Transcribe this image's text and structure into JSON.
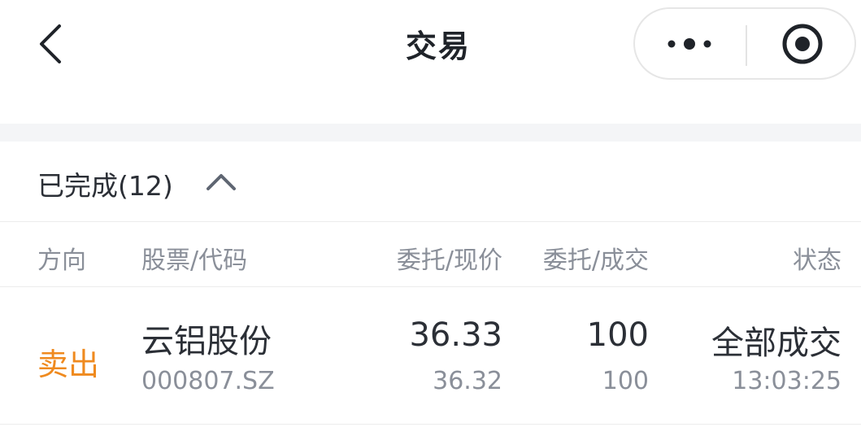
{
  "header": {
    "title": "交易",
    "back_icon": "chevron-left-icon",
    "more_icon": "more-dots-icon",
    "target_icon": "record-target-icon"
  },
  "section": {
    "title": "已完成(12)",
    "toggle_icon": "chevron-up-icon"
  },
  "columns": {
    "direction": "方向",
    "stock": "股票/代码",
    "price": "委托/现价",
    "quantity": "委托/成交",
    "status": "状态"
  },
  "orders": [
    {
      "direction": "卖出",
      "name": "云铝股份",
      "code": "000807.SZ",
      "order_price": "36.33",
      "current_price": "36.32",
      "order_qty": "100",
      "filled_qty": "100",
      "status": "全部成交",
      "time": "13:03:25"
    }
  ],
  "colors": {
    "sell": "#ef8a1f",
    "primary_text": "#1f2329",
    "secondary_text": "#8a8f99",
    "divider": "#ececec",
    "gap_bg": "#f4f5f7"
  }
}
